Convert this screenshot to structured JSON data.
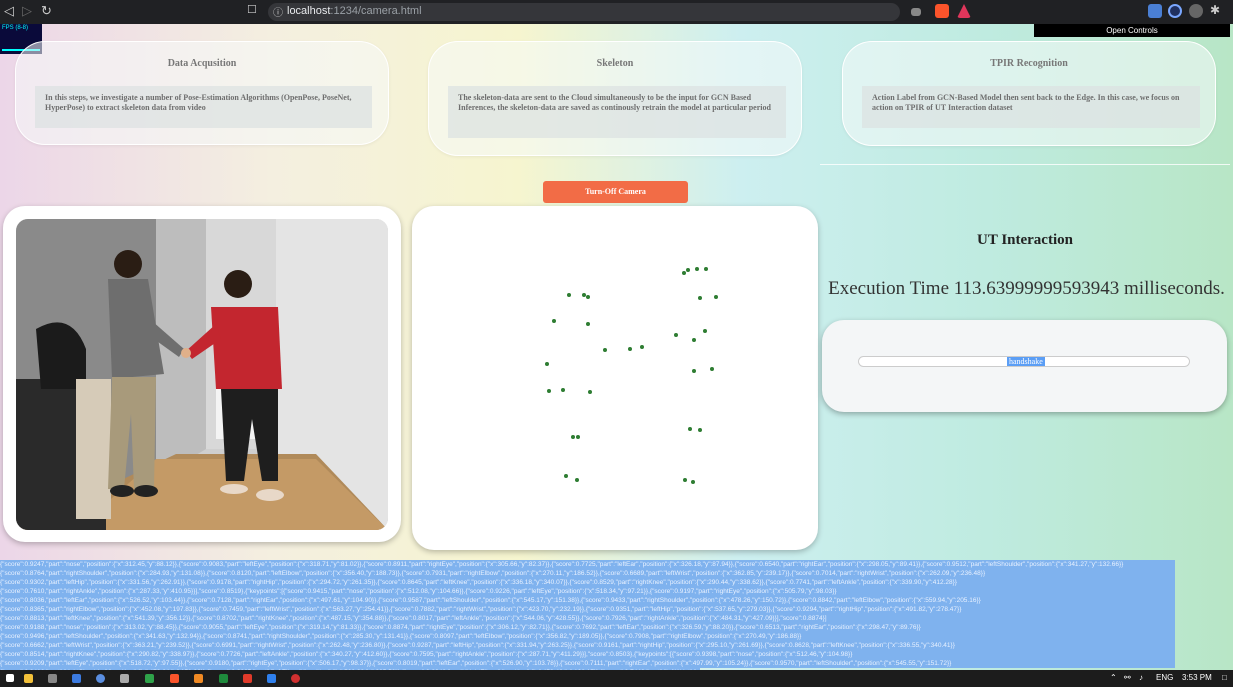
{
  "browser": {
    "url_host": "localhost",
    "url_path": ":1234/camera.html"
  },
  "open_controls": "Open Controls",
  "fps_label": "FPS (8-8)",
  "cards": [
    {
      "title": "Data Acqusition",
      "text": "In this steps, we investigate a number of Pose-Estimation Algorithms (OpenPose, PoseNet, HyperPose) to extract skeleton data from video"
    },
    {
      "title": "Skeleton",
      "text": "The skeleton-data are sent to the Cloud simultaneously to be the input for GCN Based Inferences, the skeleton-data are saved as continously retrain the model at particular period"
    },
    {
      "title": "TPIR Recognition",
      "text": "Action Label from GCN-Based Model then sent back to the Edge. In this case, we focus on action on TPIR of UT Interaction dataset"
    }
  ],
  "camera_button": "Turn-Off Camera",
  "result": {
    "title": "UT Interaction",
    "execution_time": "Execution Time 113.63999999593943 milliseconds.",
    "action_label": "handshake"
  },
  "log_lines": [
    "{\"score\":0.9247,\"part\":\"nose\",\"position\":{\"x\":312.45,\"y\":88.12}},{\"score\":0.9083,\"part\":\"leftEye\",\"position\":{\"x\":318.71,\"y\":81.02}},{\"score\":0.8911,\"part\":\"rightEye\",\"position\":{\"x\":305.66,\"y\":82.37}},{\"score\":0.7725,\"part\":\"leftEar\",\"position\":{\"x\":326.18,\"y\":87.94}},{\"score\":0.6540,\"part\":\"rightEar\",\"position\":{\"x\":298.05,\"y\":89.41}},{\"score\":0.9512,\"part\":\"leftShoulder\",\"position\":{\"x\":341.27,\"y\":132.66}}",
    "{\"score\":0.8764,\"part\":\"rightShoulder\",\"position\":{\"x\":284.93,\"y\":131.08}},{\"score\":0.8120,\"part\":\"leftElbow\",\"position\":{\"x\":356.40,\"y\":188.73}},{\"score\":0.7931,\"part\":\"rightElbow\",\"position\":{\"x\":270.11,\"y\":186.52}},{\"score\":0.6689,\"part\":\"leftWrist\",\"position\":{\"x\":362.85,\"y\":239.17}},{\"score\":0.7014,\"part\":\"rightWrist\",\"position\":{\"x\":262.09,\"y\":236.48}}",
    "{\"score\":0.9302,\"part\":\"leftHip\",\"position\":{\"x\":331.56,\"y\":262.91}},{\"score\":0.9178,\"part\":\"rightHip\",\"position\":{\"x\":294.72,\"y\":261.35}},{\"score\":0.8645,\"part\":\"leftKnee\",\"position\":{\"x\":336.18,\"y\":340.07}},{\"score\":0.8529,\"part\":\"rightKnee\",\"position\":{\"x\":290.44,\"y\":338.62}},{\"score\":0.7741,\"part\":\"leftAnkle\",\"position\":{\"x\":339.90,\"y\":412.28}}",
    "{\"score\":0.7610,\"part\":\"rightAnkle\",\"position\":{\"x\":287.33,\"y\":410.95}}],\"score\":0.8519},{\"keypoints\":[{\"score\":0.9415,\"part\":\"nose\",\"position\":{\"x\":512.08,\"y\":104.66}},{\"score\":0.9226,\"part\":\"leftEye\",\"position\":{\"x\":518.34,\"y\":97.21}},{\"score\":0.9197,\"part\":\"rightEye\",\"position\":{\"x\":505.79,\"y\":98.03}}",
    "{\"score\":0.8036,\"part\":\"leftEar\",\"position\":{\"x\":526.52,\"y\":103.44}},{\"score\":0.7128,\"part\":\"rightEar\",\"position\":{\"x\":497.61,\"y\":104.90}},{\"score\":0.9587,\"part\":\"leftShoulder\",\"position\":{\"x\":545.17,\"y\":151.38}},{\"score\":0.9433,\"part\":\"rightShoulder\",\"position\":{\"x\":478.26,\"y\":150.72}},{\"score\":0.8842,\"part\":\"leftElbow\",\"position\":{\"x\":559.94,\"y\":205.16}}",
    "{\"score\":0.8365,\"part\":\"rightElbow\",\"position\":{\"x\":452.08,\"y\":197.83}},{\"score\":0.7459,\"part\":\"leftWrist\",\"position\":{\"x\":563.27,\"y\":254.41}},{\"score\":0.7882,\"part\":\"rightWrist\",\"position\":{\"x\":423.70,\"y\":232.19}},{\"score\":0.9351,\"part\":\"leftHip\",\"position\":{\"x\":537.65,\"y\":279.03}},{\"score\":0.9294,\"part\":\"rightHip\",\"position\":{\"x\":491.82,\"y\":278.47}}",
    "{\"score\":0.8813,\"part\":\"leftKnee\",\"position\":{\"x\":541.39,\"y\":356.12}},{\"score\":0.8702,\"part\":\"rightKnee\",\"position\":{\"x\":487.15,\"y\":354.88}},{\"score\":0.8017,\"part\":\"leftAnkle\",\"position\":{\"x\":544.06,\"y\":428.55}},{\"score\":0.7926,\"part\":\"rightAnkle\",\"position\":{\"x\":484.31,\"y\":427.09}}],\"score\":0.8874}]",
    "{\"score\":0.9188,\"part\":\"nose\",\"position\":{\"x\":313.02,\"y\":88.45}},{\"score\":0.9055,\"part\":\"leftEye\",\"position\":{\"x\":319.14,\"y\":81.33}},{\"score\":0.8874,\"part\":\"rightEye\",\"position\":{\"x\":306.12,\"y\":82.71}},{\"score\":0.7692,\"part\":\"leftEar\",\"position\":{\"x\":326.59,\"y\":88.20}},{\"score\":0.6513,\"part\":\"rightEar\",\"position\":{\"x\":298.47,\"y\":89.76}}",
    "{\"score\":0.9496,\"part\":\"leftShoulder\",\"position\":{\"x\":341.63,\"y\":132.94}},{\"score\":0.8741,\"part\":\"rightShoulder\",\"position\":{\"x\":285.30,\"y\":131.41}},{\"score\":0.8097,\"part\":\"leftElbow\",\"position\":{\"x\":356.82,\"y\":189.05}},{\"score\":0.7908,\"part\":\"rightElbow\",\"position\":{\"x\":270.49,\"y\":186.88}}",
    "{\"score\":0.6662,\"part\":\"leftWrist\",\"position\":{\"x\":363.21,\"y\":239.52}},{\"score\":0.6991,\"part\":\"rightWrist\",\"position\":{\"x\":262.48,\"y\":236.80}},{\"score\":0.9287,\"part\":\"leftHip\",\"position\":{\"x\":331.94,\"y\":263.25}},{\"score\":0.9161,\"part\":\"rightHip\",\"position\":{\"x\":295.10,\"y\":261.69}},{\"score\":0.8628,\"part\":\"leftKnee\",\"position\":{\"x\":336.55,\"y\":340.41}}",
    "{\"score\":0.8514,\"part\":\"rightKnee\",\"position\":{\"x\":290.82,\"y\":338.97}},{\"score\":0.7726,\"part\":\"leftAnkle\",\"position\":{\"x\":340.27,\"y\":412.60}},{\"score\":0.7595,\"part\":\"rightAnkle\",\"position\":{\"x\":287.71,\"y\":411.29}}],\"score\":0.8503},{\"keypoints\":[{\"score\":0.9398,\"part\":\"nose\",\"position\":{\"x\":512.46,\"y\":104.98}}",
    "{\"score\":0.9209,\"part\":\"leftEye\",\"position\":{\"x\":518.72,\"y\":97.55}},{\"score\":0.9180,\"part\":\"rightEye\",\"position\":{\"x\":506.17,\"y\":98.37}},{\"score\":0.8019,\"part\":\"leftEar\",\"position\":{\"x\":526.90,\"y\":103.78}},{\"score\":0.7111,\"part\":\"rightEar\",\"position\":{\"x\":497.99,\"y\":105.24}},{\"score\":0.9570,\"part\":\"leftShoulder\",\"position\":{\"x\":545.55,\"y\":151.72}}",
    "{\"score\":0.9416,\"part\":\"rightShoulder\",\"position\":{\"x\":478.64,\"y\":151.06}},{\"score\":0.8825,\"part\":\"leftElbow\",\"position\":{\"x\":560.32,\"y\":205.50}},{\"score\":0.8348,\"part\":\"rightElbow\",\"position\":{\"x\":452.46,\"y\":198.17}},{\"score\":0.7442,\"part\":\"leftWrist\",\"position\":{\"x\":563.65,\"y\":254.75}}"
  ],
  "taskbar": {
    "language": "ENG",
    "time": "3:53 PM"
  },
  "colors": {
    "button": "#f26c46",
    "keypoint": "#2e7d32",
    "log_highlight": "#7fb2ee",
    "label_highlight": "#5b9ef5"
  }
}
